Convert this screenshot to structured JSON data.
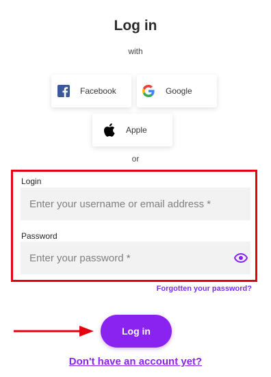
{
  "title": "Log in",
  "with_text": "with",
  "social": {
    "facebook": {
      "label": "Facebook",
      "icon": "facebook-icon",
      "color": "#3b5998"
    },
    "google": {
      "label": "Google",
      "icon": "google-icon"
    },
    "apple": {
      "label": "Apple",
      "icon": "apple-icon",
      "color": "#000000"
    }
  },
  "or_text": "or",
  "form": {
    "login_label": "Login",
    "login_placeholder": "Enter your username or email address *",
    "login_value": "",
    "password_label": "Password",
    "password_placeholder": "Enter your password *",
    "password_value": ""
  },
  "forgot_link": "Forgotten your password?",
  "login_button": "Log in",
  "signup_link": "Don't have an account yet?",
  "colors": {
    "accent": "#8a22f0",
    "highlight": "#e3000f",
    "field_bg": "#f2f2f2"
  }
}
